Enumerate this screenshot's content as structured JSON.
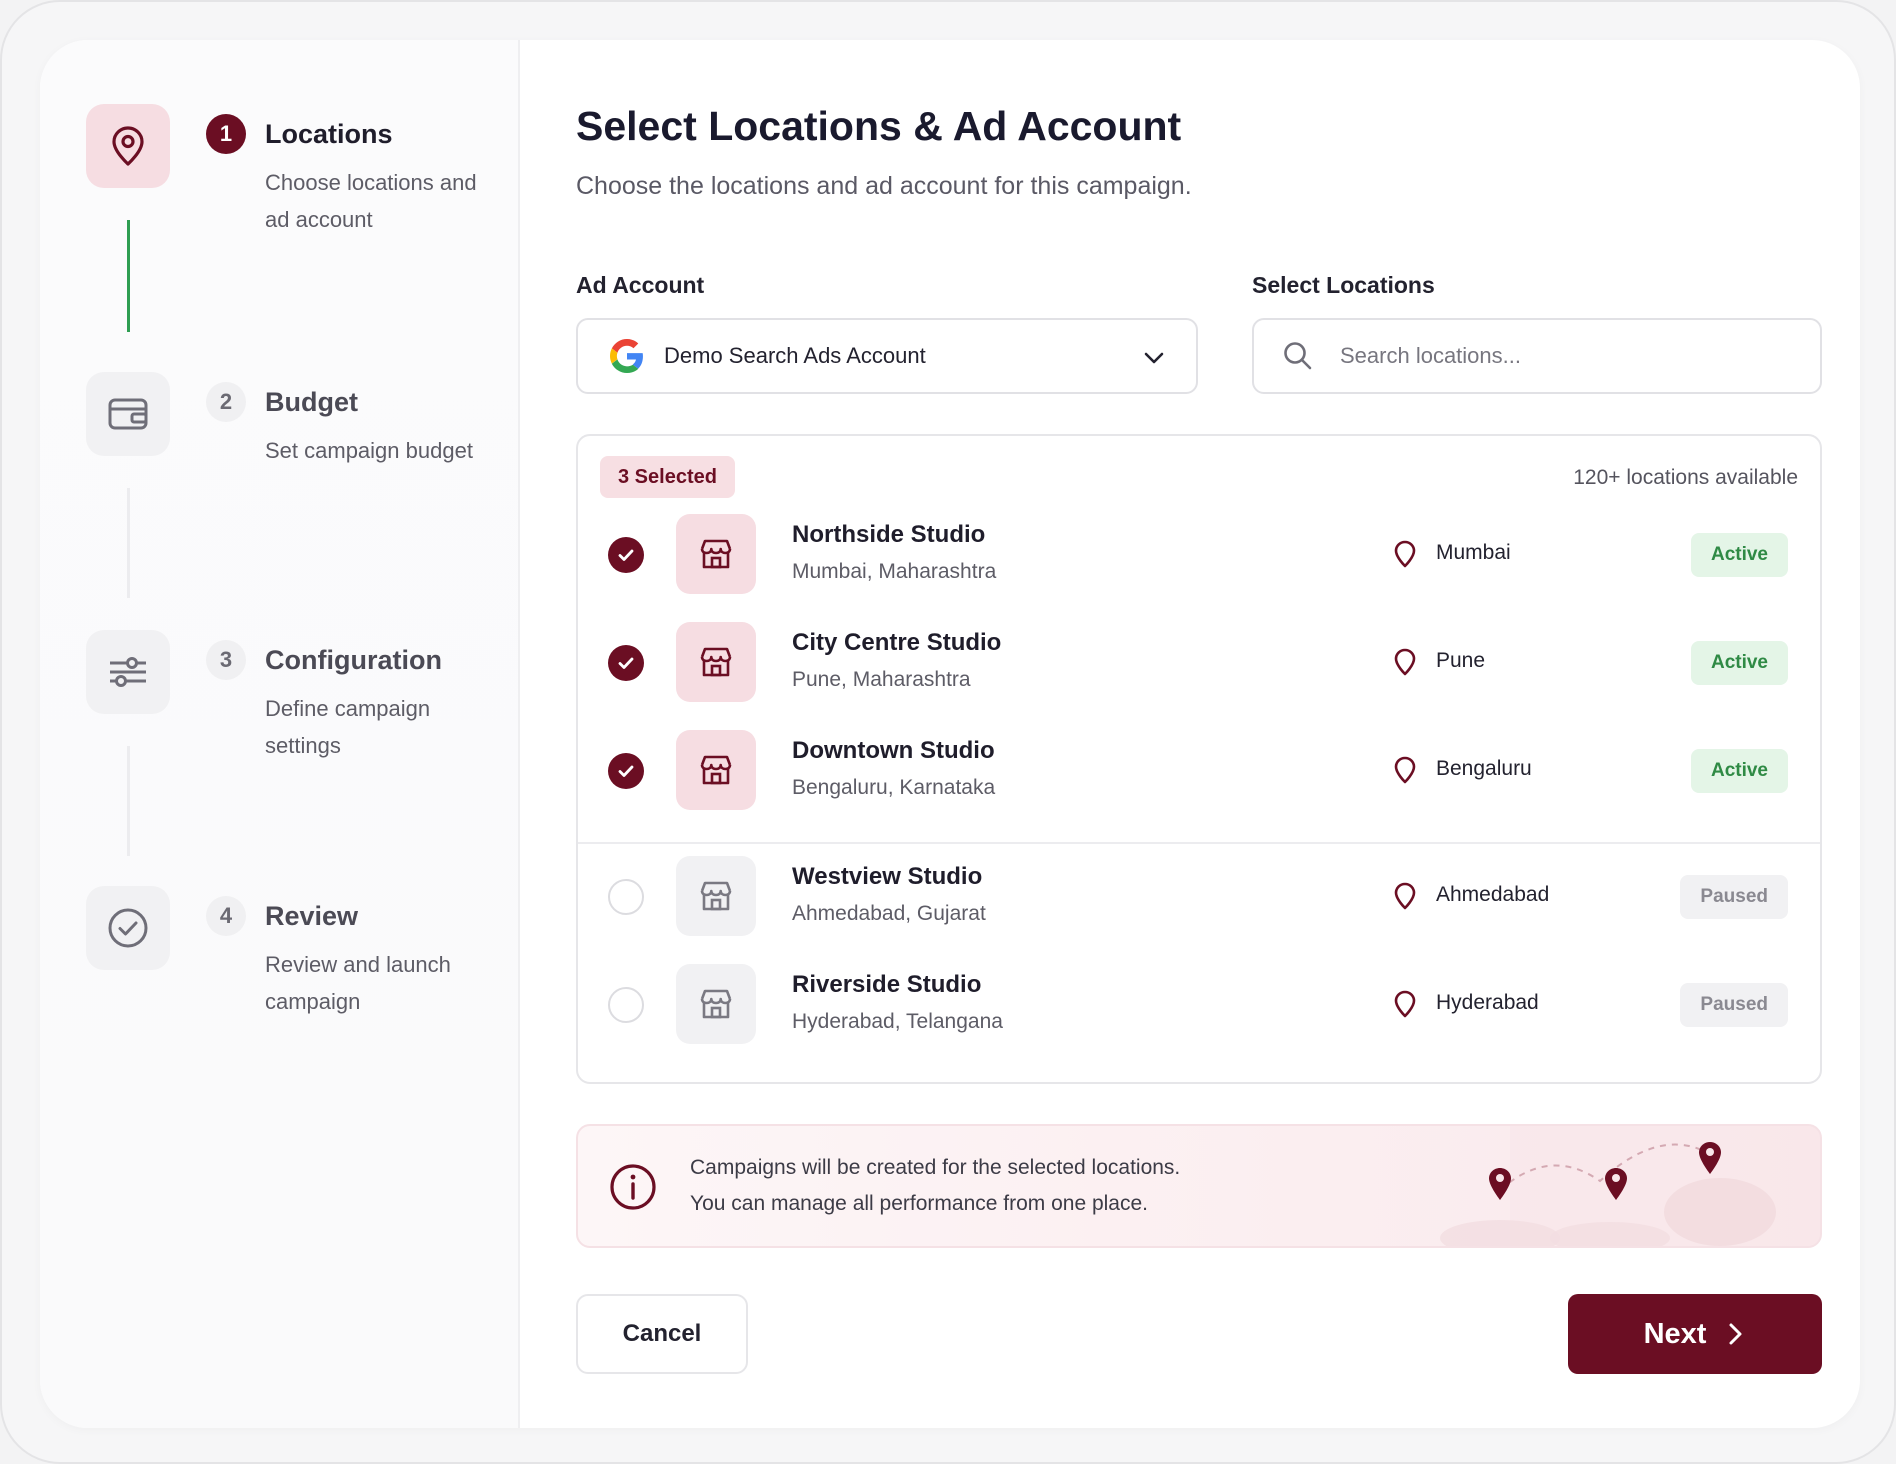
{
  "stepper": {
    "steps": [
      {
        "num": "1",
        "title": "Locations",
        "desc": "Choose locations and ad account",
        "icon": "location-pin-icon",
        "state": "active"
      },
      {
        "num": "2",
        "title": "Budget",
        "desc": "Set campaign budget",
        "icon": "wallet-icon",
        "state": "pending"
      },
      {
        "num": "3",
        "title": "Configuration",
        "desc": "Define campaign settings",
        "icon": "sliders-icon",
        "state": "pending"
      },
      {
        "num": "4",
        "title": "Review",
        "desc": "Review and launch campaign",
        "icon": "check-circle-icon",
        "state": "pending"
      }
    ]
  },
  "header": {
    "title": "Select Locations & Ad Account",
    "subtitle": "Choose the locations and ad account for this campaign."
  },
  "ad_account": {
    "label": "Ad Account",
    "value": "Demo Search Ads Account",
    "icon": "google-logo-icon"
  },
  "locations_search": {
    "label": "Select Locations",
    "placeholder": "Search locations...",
    "value": ""
  },
  "location_list": {
    "selected_badge": "3 Selected",
    "available_text": "120+ locations available",
    "items": [
      {
        "name": "Northside Studio",
        "address": "Mumbai, Maharashtra",
        "city": "Mumbai",
        "status": "Active",
        "selected": true
      },
      {
        "name": "City Centre Studio",
        "address": "Pune, Maharashtra",
        "city": "Pune",
        "status": "Active",
        "selected": true
      },
      {
        "name": "Downtown Studio",
        "address": "Bengaluru, Karnataka",
        "city": "Bengaluru",
        "status": "Active",
        "selected": true
      },
      {
        "name": "Westview Studio",
        "address": "Ahmedabad, Gujarat",
        "city": "Ahmedabad",
        "status": "Paused",
        "selected": false
      },
      {
        "name": "Riverside Studio",
        "address": "Hyderabad, Telangana",
        "city": "Hyderabad",
        "status": "Paused",
        "selected": false
      }
    ]
  },
  "info": {
    "line1": "Campaigns will be created for the selected locations.",
    "line2": "You can manage all performance from one place."
  },
  "footer": {
    "cancel_label": "Cancel",
    "next_label": "Next"
  },
  "colors": {
    "brand": "#6b0e23",
    "active_green": "#2f8a45",
    "progress_green": "#2f9e52"
  }
}
